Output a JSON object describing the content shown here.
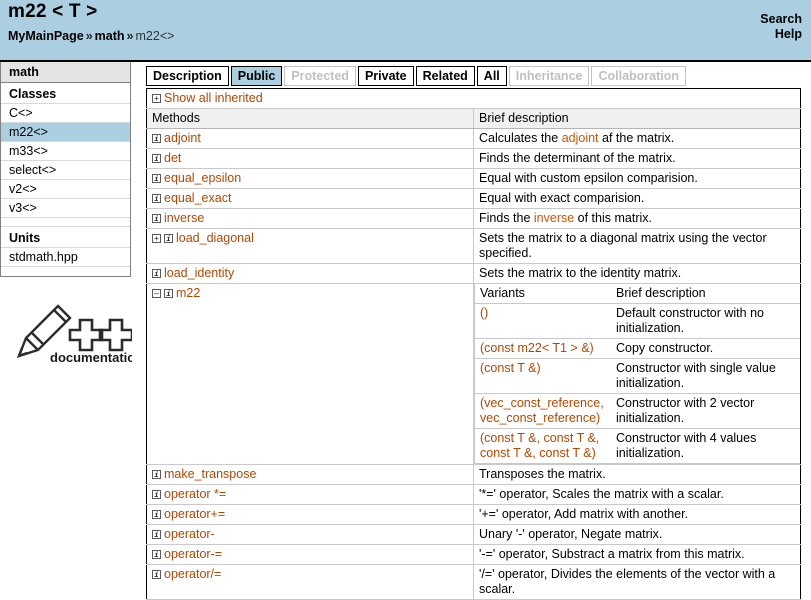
{
  "header": {
    "title": "m22 < T >",
    "breadcrumb": {
      "root": "MyMainPage",
      "sep1": "»",
      "middle": "math",
      "sep2": "»",
      "current": "m22<>"
    },
    "links": [
      {
        "label": "Search",
        "name": "search-link"
      },
      {
        "label": "Help",
        "name": "help-link"
      }
    ]
  },
  "sidebar": {
    "title": "math",
    "sections": [
      {
        "label": "Classes",
        "items": [
          {
            "label": "C<>",
            "selected": false
          },
          {
            "label": "m22<>",
            "selected": true
          },
          {
            "label": "m33<>",
            "selected": false
          },
          {
            "label": "select<>",
            "selected": false
          },
          {
            "label": "v2<>",
            "selected": false
          },
          {
            "label": "v3<>",
            "selected": false
          }
        ]
      },
      {
        "label": "Units",
        "items": [
          {
            "label": "stdmath.hpp",
            "selected": false
          }
        ]
      }
    ],
    "logo": {
      "text": "documentation",
      "icon": "pencil-plus-plus-icon"
    }
  },
  "tabs": [
    {
      "label": "Description",
      "state": "normal"
    },
    {
      "label": "Public",
      "state": "active"
    },
    {
      "label": "Protected",
      "state": "disabled"
    },
    {
      "label": "Private",
      "state": "normal"
    },
    {
      "label": "Related",
      "state": "normal"
    },
    {
      "label": "All",
      "state": "normal"
    },
    {
      "label": "Inheritance",
      "state": "disabled"
    },
    {
      "label": "Collaboration",
      "state": "disabled"
    }
  ],
  "content": {
    "show_all_inherited": "Show all inherited",
    "columns": {
      "methods": "Methods",
      "brief": "Brief description"
    },
    "variants_columns": {
      "variants": "Variants",
      "brief": "Brief description"
    },
    "rows": [
      {
        "name": "adjoint",
        "icons": [
          "info"
        ],
        "desc_pre": "Calculates the ",
        "desc_link": "adjoint",
        "desc_post": " af the matrix."
      },
      {
        "name": "det",
        "icons": [
          "info"
        ],
        "desc_pre": "Finds the determinant of the matrix.",
        "desc_link": "",
        "desc_post": ""
      },
      {
        "name": "equal_epsilon",
        "icons": [
          "info"
        ],
        "desc_pre": "Equal with custom epsilon comparision.",
        "desc_link": "",
        "desc_post": ""
      },
      {
        "name": "equal_exact",
        "icons": [
          "info"
        ],
        "desc_pre": "Equal with exact comparision.",
        "desc_link": "",
        "desc_post": ""
      },
      {
        "name": "inverse",
        "icons": [
          "info"
        ],
        "desc_pre": "Finds the ",
        "desc_link": "inverse",
        "desc_post": " of this matrix."
      },
      {
        "name": "load_diagonal",
        "icons": [
          "plus",
          "info"
        ],
        "desc_pre": "Sets the matrix to a diagonal matrix using the vector specified.",
        "desc_link": "",
        "desc_post": ""
      },
      {
        "name": "load_identity",
        "icons": [
          "info"
        ],
        "desc_pre": "Sets the matrix to the identity matrix.",
        "desc_link": "",
        "desc_post": ""
      }
    ],
    "expanded_row": {
      "name": "m22",
      "icons": [
        "minus",
        "info"
      ],
      "variants": [
        {
          "signature": "()",
          "desc": "Default constructor with no initialization."
        },
        {
          "signature": "(const m22< T1 > &)",
          "desc": "Copy constructor."
        },
        {
          "signature": "(const T &)",
          "desc": "Constructor with single value initialization."
        },
        {
          "signature": "(vec_const_reference, vec_const_reference)",
          "desc": "Constructor with 2 vector initialization."
        },
        {
          "signature": "(const T &, const T &, const T &, const T &)",
          "desc": "Constructor with 4 values initialization."
        }
      ]
    },
    "rows_after": [
      {
        "name": "make_transpose",
        "icons": [
          "info"
        ],
        "desc_pre": "Transposes the matrix.",
        "desc_link": "",
        "desc_post": ""
      },
      {
        "name": "operator *=",
        "icons": [
          "info"
        ],
        "desc_pre": "'*=' operator, Scales the matrix with a scalar.",
        "desc_link": "",
        "desc_post": ""
      },
      {
        "name": "operator+=",
        "icons": [
          "info"
        ],
        "desc_pre": "'+=' operator, Add matrix with another.",
        "desc_link": "",
        "desc_post": ""
      },
      {
        "name": "operator-",
        "icons": [
          "info"
        ],
        "desc_pre": "Unary '-' operator, Negate matrix.",
        "desc_link": "",
        "desc_post": ""
      },
      {
        "name": "operator-=",
        "icons": [
          "info"
        ],
        "desc_pre": "'-=' operator, Substract a matrix from this matrix.",
        "desc_link": "",
        "desc_post": ""
      },
      {
        "name": "operator/=",
        "icons": [
          "info"
        ],
        "desc_pre": "'/=' operator, Divides the elements of the vector with a scalar.",
        "desc_link": "",
        "desc_post": ""
      }
    ]
  },
  "colors": {
    "header_blue": "#abcee1",
    "link_orange": "#b34700",
    "table_header_gray": "#f0f0f0"
  }
}
